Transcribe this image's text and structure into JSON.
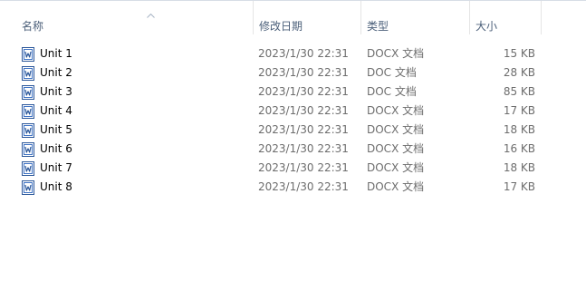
{
  "columns": {
    "name": "名称",
    "date": "修改日期",
    "type": "类型",
    "size": "大小"
  },
  "files": [
    {
      "name": "Unit 1",
      "date": "2023/1/30 22:31",
      "type": "DOCX 文档",
      "size": "15 KB"
    },
    {
      "name": "Unit 2",
      "date": "2023/1/30 22:31",
      "type": "DOC 文档",
      "size": "28 KB"
    },
    {
      "name": "Unit 3",
      "date": "2023/1/30 22:31",
      "type": "DOC 文档",
      "size": "85 KB"
    },
    {
      "name": "Unit 4",
      "date": "2023/1/30 22:31",
      "type": "DOCX 文档",
      "size": "17 KB"
    },
    {
      "name": "Unit 5",
      "date": "2023/1/30 22:31",
      "type": "DOCX 文档",
      "size": "18 KB"
    },
    {
      "name": "Unit 6",
      "date": "2023/1/30 22:31",
      "type": "DOCX 文档",
      "size": "16 KB"
    },
    {
      "name": "Unit 7",
      "date": "2023/1/30 22:31",
      "type": "DOCX 文档",
      "size": "18 KB"
    },
    {
      "name": "Unit 8",
      "date": "2023/1/30 22:31",
      "type": "DOCX 文档",
      "size": "17 KB"
    }
  ],
  "icon": "word-document-icon",
  "colors": {
    "header_text": "#4c607a",
    "detail_text": "#6d6d6d",
    "icon_blue": "#2b579a"
  }
}
